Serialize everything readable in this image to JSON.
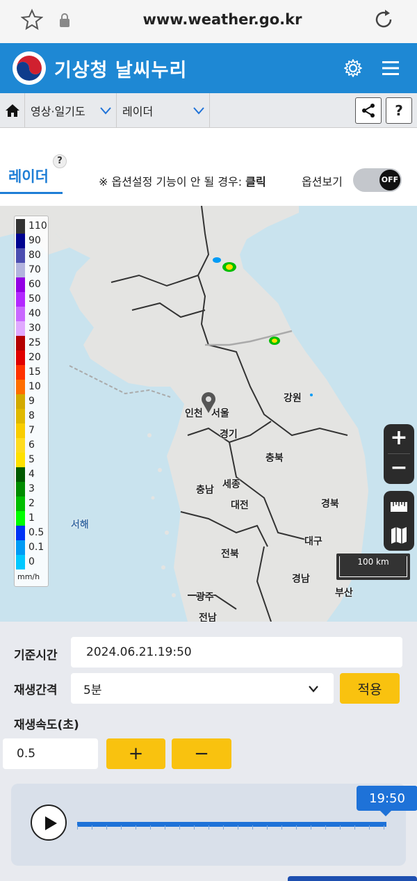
{
  "browser": {
    "url": "www.weather.go.kr",
    "icons": [
      "star-icon",
      "lock-icon",
      "reload-icon"
    ]
  },
  "header": {
    "title": "기상청 날씨누리",
    "icons": [
      "kma-logo",
      "gear-icon",
      "hamburger-menu-icon"
    ],
    "bg_color": "#1e88d4"
  },
  "nav": {
    "dropdown1": "영상·일기도",
    "dropdown2": "레이더",
    "help": "?"
  },
  "tab": {
    "label": "레이더",
    "help": "?"
  },
  "notice": {
    "prefix": "※ 옵션설정 기능이 안 될 경우: ",
    "link": "클릭"
  },
  "options": {
    "label": "옵션보기",
    "toggle_state": "OFF"
  },
  "map": {
    "labels": [
      "강원",
      "인천",
      "서울",
      "경기",
      "충북",
      "충남",
      "세종",
      "대전",
      "경북",
      "대구",
      "전북",
      "경남",
      "광주",
      "부산",
      "전남"
    ],
    "sea_label": "서해",
    "scale": "100 km",
    "zoom_in": "+",
    "zoom_out": "−"
  },
  "legend": {
    "unit": "mm/h",
    "levels": [
      {
        "value": "110",
        "color": "#333333"
      },
      {
        "value": "90",
        "color": "#000390"
      },
      {
        "value": "80",
        "color": "#4c4eb1"
      },
      {
        "value": "70",
        "color": "#b3b4de"
      },
      {
        "value": "60",
        "color": "#9300e4"
      },
      {
        "value": "50",
        "color": "#b329ff"
      },
      {
        "value": "40",
        "color": "#c969ff"
      },
      {
        "value": "30",
        "color": "#e0a9ff"
      },
      {
        "value": "25",
        "color": "#b40000"
      },
      {
        "value": "20",
        "color": "#e00000"
      },
      {
        "value": "15",
        "color": "#ff3200"
      },
      {
        "value": "10",
        "color": "#ff6e00"
      },
      {
        "value": "9",
        "color": "#d2aa00"
      },
      {
        "value": "8",
        "color": "#e0b900"
      },
      {
        "value": "7",
        "color": "#f9cd00"
      },
      {
        "value": "6",
        "color": "#ffdc1f"
      },
      {
        "value": "5",
        "color": "#ffe100"
      },
      {
        "value": "4",
        "color": "#005a00"
      },
      {
        "value": "3",
        "color": "#008c00"
      },
      {
        "value": "2",
        "color": "#00be00"
      },
      {
        "value": "1",
        "color": "#00ff00"
      },
      {
        "value": "0.5",
        "color": "#0033f5"
      },
      {
        "value": "0.1",
        "color": "#009bf5"
      },
      {
        "value": "0",
        "color": "#00c8ff"
      }
    ]
  },
  "controls": {
    "base_time_label": "기준시간",
    "base_time_value": "2024.06.21.19:50",
    "interval_label": "재생간격",
    "interval_value": "5분",
    "apply_button": "적용",
    "speed_label": "재생속도(초)",
    "speed_value": "0.5",
    "plus_button": "+",
    "minus_button": "−",
    "current_time": "19:50",
    "accent_color": "#f9c20f",
    "track_color": "#1e72d8"
  }
}
